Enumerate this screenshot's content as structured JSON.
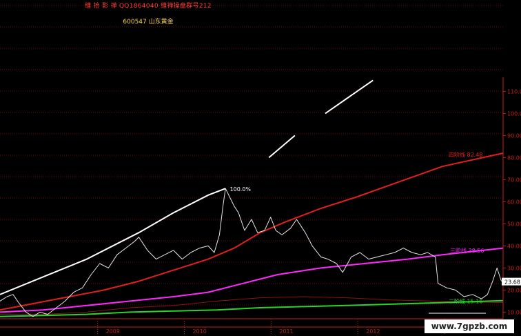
{
  "header": {
    "line1": "缠 拾 影 禅    QQ1864040  缠禅操盘群号212",
    "line2": "600547  山东黄金"
  },
  "watermark": "www.7gpzb.com",
  "colors": {
    "background": "#000000",
    "price": "#e8e8e8",
    "wedge": "#ffffff",
    "red_ma": "#e0201e",
    "magenta_ma": "#ff28ff",
    "green_ma": "#2ad42a",
    "darkred_ma": "#8a1414",
    "axis": "#c81e1e",
    "grid": "#6a0c0c"
  },
  "chart_data": {
    "type": "line",
    "yticks": [
      "110.00",
      "100.00",
      "90.00",
      "80.00",
      "70.00",
      "60.00",
      "50.00",
      "40.00",
      "30.00",
      "20.00",
      "10.00"
    ],
    "xlabels": [
      "2009",
      "2010",
      "2011",
      "2012",
      "2013"
    ],
    "ylim": [
      7,
      117
    ],
    "x": [
      2008.0,
      2013.8
    ],
    "annotations": {
      "peak_label": "100.0%",
      "last_price": "23.68",
      "red_label": "四阶线  82.48",
      "magenta_label": "三阶线  38.56",
      "green_label": "二阶线  15.16"
    },
    "series": [
      {
        "key": "price",
        "points": [
          [
            2008.0,
            15
          ],
          [
            2008.08,
            17
          ],
          [
            2008.15,
            18
          ],
          [
            2008.22,
            14
          ],
          [
            2008.3,
            10
          ],
          [
            2008.38,
            8
          ],
          [
            2008.46,
            10
          ],
          [
            2008.55,
            9
          ],
          [
            2008.65,
            12
          ],
          [
            2008.75,
            15
          ],
          [
            2008.85,
            19
          ],
          [
            2008.95,
            21
          ],
          [
            2009.05,
            27
          ],
          [
            2009.15,
            32
          ],
          [
            2009.25,
            30
          ],
          [
            2009.35,
            36
          ],
          [
            2009.45,
            39
          ],
          [
            2009.55,
            42
          ],
          [
            2009.6,
            44
          ],
          [
            2009.7,
            38
          ],
          [
            2009.8,
            34
          ],
          [
            2009.9,
            36
          ],
          [
            2010.0,
            38
          ],
          [
            2010.1,
            34
          ],
          [
            2010.2,
            37
          ],
          [
            2010.3,
            39
          ],
          [
            2010.4,
            40
          ],
          [
            2010.47,
            37
          ],
          [
            2010.53,
            45
          ],
          [
            2010.57,
            58
          ],
          [
            2010.6,
            66
          ],
          [
            2010.65,
            62
          ],
          [
            2010.7,
            58
          ],
          [
            2010.75,
            55
          ],
          [
            2010.82,
            47
          ],
          [
            2010.9,
            52
          ],
          [
            2010.97,
            46
          ],
          [
            2011.05,
            47
          ],
          [
            2011.12,
            53
          ],
          [
            2011.18,
            47
          ],
          [
            2011.25,
            45
          ],
          [
            2011.35,
            48
          ],
          [
            2011.42,
            52
          ],
          [
            2011.52,
            46
          ],
          [
            2011.6,
            40
          ],
          [
            2011.7,
            35
          ],
          [
            2011.78,
            34
          ],
          [
            2011.88,
            32
          ],
          [
            2011.95,
            28
          ],
          [
            2012.05,
            35
          ],
          [
            2012.15,
            37
          ],
          [
            2012.25,
            34
          ],
          [
            2012.35,
            35
          ],
          [
            2012.45,
            36
          ],
          [
            2012.55,
            37
          ],
          [
            2012.65,
            39
          ],
          [
            2012.75,
            37
          ],
          [
            2012.85,
            36
          ],
          [
            2012.93,
            37
          ],
          [
            2013.02,
            35
          ],
          [
            2013.05,
            23
          ],
          [
            2013.15,
            21
          ],
          [
            2013.25,
            20
          ],
          [
            2013.35,
            17
          ],
          [
            2013.45,
            18
          ],
          [
            2013.55,
            16
          ],
          [
            2013.62,
            18
          ],
          [
            2013.68,
            24
          ],
          [
            2013.73,
            30
          ],
          [
            2013.78,
            24
          ]
        ]
      },
      {
        "key": "wedge",
        "segments": [
          [
            [
              2008.0,
              18
            ],
            [
              2008.5,
              26
            ],
            [
              2009.0,
              34
            ],
            [
              2009.35,
              41
            ],
            [
              2009.6,
              46
            ],
            [
              2010.0,
              55
            ],
            [
              2010.4,
              63
            ],
            [
              2010.6,
              66
            ]
          ],
          [
            [
              2011.1,
              80
            ],
            [
              2011.4,
              90
            ]
          ],
          [
            [
              2011.75,
              100
            ],
            [
              2012.3,
              115
            ]
          ]
        ]
      },
      {
        "key": "red_ma",
        "points": [
          [
            2008.0,
            11
          ],
          [
            2008.4,
            14
          ],
          [
            2008.8,
            17
          ],
          [
            2009.2,
            20
          ],
          [
            2009.6,
            24
          ],
          [
            2010.0,
            29
          ],
          [
            2010.4,
            34
          ],
          [
            2010.7,
            39
          ],
          [
            2011.0,
            46
          ],
          [
            2011.3,
            51
          ],
          [
            2011.7,
            57
          ],
          [
            2012.1,
            62
          ],
          [
            2012.6,
            69
          ],
          [
            2013.1,
            76
          ],
          [
            2013.8,
            82
          ]
        ]
      },
      {
        "key": "magenta_ma",
        "points": [
          [
            2008.0,
            10
          ],
          [
            2008.5,
            11
          ],
          [
            2009.0,
            13
          ],
          [
            2009.5,
            15
          ],
          [
            2010.0,
            17
          ],
          [
            2010.4,
            19
          ],
          [
            2010.8,
            23
          ],
          [
            2011.2,
            27
          ],
          [
            2011.7,
            30
          ],
          [
            2012.2,
            32
          ],
          [
            2012.7,
            34
          ],
          [
            2013.1,
            36
          ],
          [
            2013.8,
            39
          ]
        ]
      },
      {
        "key": "green_ma",
        "points": [
          [
            2008.0,
            8
          ],
          [
            2008.5,
            8.5
          ],
          [
            2009.0,
            9
          ],
          [
            2009.5,
            10
          ],
          [
            2010.0,
            10.5
          ],
          [
            2010.5,
            11
          ],
          [
            2011.0,
            12
          ],
          [
            2011.5,
            12.5
          ],
          [
            2012.0,
            13
          ],
          [
            2012.5,
            13.6
          ],
          [
            2013.0,
            14.2
          ],
          [
            2013.8,
            15.2
          ]
        ]
      },
      {
        "key": "darkred_ma",
        "points": [
          [
            2008.0,
            9
          ],
          [
            2008.5,
            9
          ],
          [
            2009.0,
            10
          ],
          [
            2009.5,
            12
          ],
          [
            2010.0,
            13
          ],
          [
            2010.5,
            15
          ],
          [
            2011.0,
            16.5
          ],
          [
            2011.5,
            17
          ],
          [
            2012.0,
            16.5
          ],
          [
            2012.5,
            15.5
          ],
          [
            2013.0,
            15
          ],
          [
            2013.5,
            14.5
          ],
          [
            2013.8,
            14.3
          ]
        ]
      }
    ]
  }
}
